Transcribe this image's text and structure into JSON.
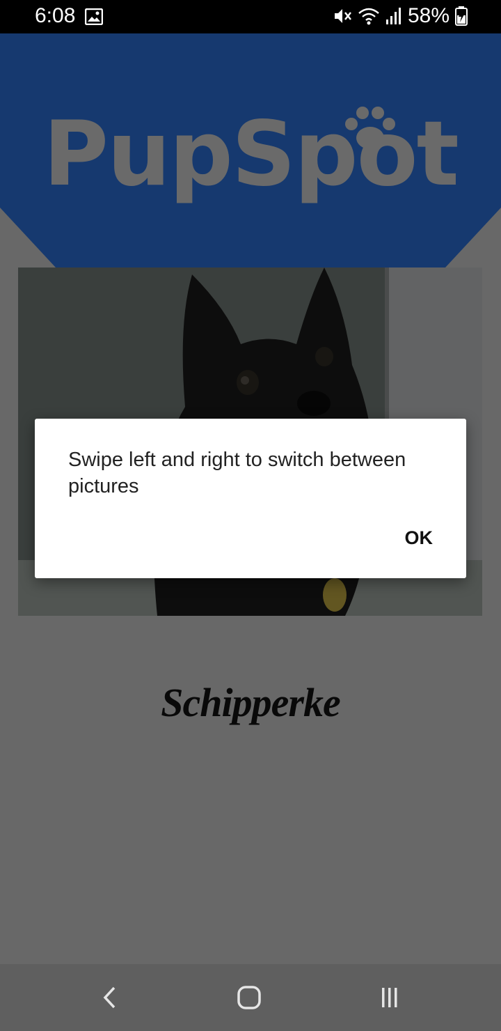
{
  "status_bar": {
    "time": "6:08",
    "battery": "58%",
    "icons": [
      "gallery-icon",
      "mute-icon",
      "wifi-icon",
      "signal-icon",
      "battery-charging-icon"
    ]
  },
  "header": {
    "logo_text": "PupSpot",
    "brand_color": "#2b6cd1",
    "logo_color": "#c9c9c9"
  },
  "photo": {
    "subject": "black dog"
  },
  "breed": {
    "name": "Schipperke"
  },
  "dialog": {
    "message": "Swipe left and right to switch between pictures",
    "ok_label": "OK"
  },
  "nav_bar": {
    "icons": [
      "back-icon",
      "home-icon",
      "recents-icon"
    ]
  }
}
